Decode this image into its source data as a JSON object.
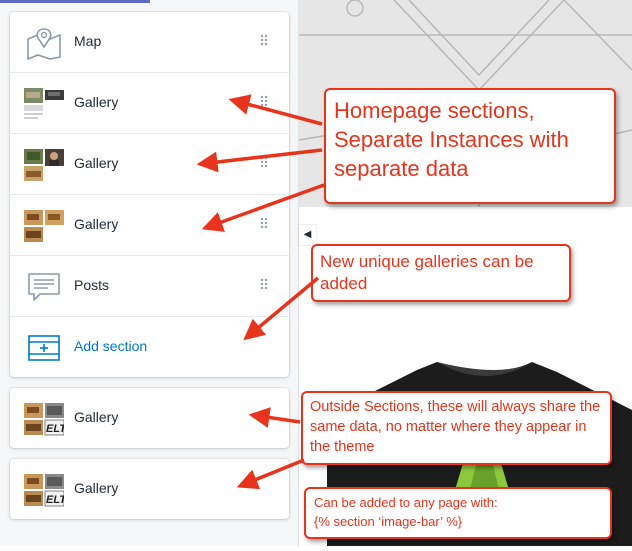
{
  "sections": [
    {
      "label": "Map",
      "icon": "map-icon"
    },
    {
      "label": "Gallery",
      "icon": "gallery-thumbnail"
    },
    {
      "label": "Gallery",
      "icon": "gallery-thumbnail"
    },
    {
      "label": "Gallery",
      "icon": "gallery-thumbnail"
    },
    {
      "label": "Posts",
      "icon": "posts-icon"
    }
  ],
  "add_section_label": "Add section",
  "outside_sections": [
    {
      "label": "Gallery",
      "icon": "gallery-thumbnail"
    },
    {
      "label": "Gallery",
      "icon": "gallery-thumbnail"
    }
  ],
  "annotations": {
    "homepage": "Homepage sections, Separate Instances with separate data",
    "new_galleries": "New unique galleries can be added",
    "outside": "Outside Sections, these will always share the same data, no matter where they appear in the theme",
    "any_page_line1": "Can be added to any page with:",
    "any_page_line2": "{% section ‘image-bar’ %}"
  },
  "colors": {
    "annotation": "#e8341c",
    "link": "#007ace",
    "text": "#212b36"
  }
}
